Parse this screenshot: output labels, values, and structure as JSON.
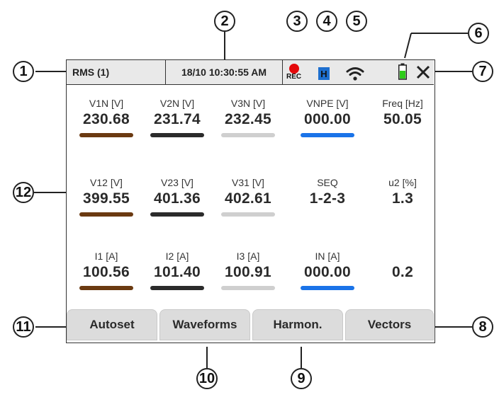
{
  "status": {
    "mode": "RMS (1)",
    "datetime": "18/10 10:30:55 AM",
    "rec_label": "REC",
    "hold_badge": "H",
    "icons": [
      "record-icon",
      "hold-icon",
      "wifi-icon",
      "battery-icon",
      "close-icon"
    ]
  },
  "grid": {
    "rows": [
      [
        {
          "label": "V1N [V]",
          "value": "230.68",
          "bar": "#6b3a11"
        },
        {
          "label": "V2N [V]",
          "value": "231.74",
          "bar": "#2b2b2b"
        },
        {
          "label": "V3N [V]",
          "value": "232.45",
          "bar": "#cfcfcf"
        },
        {
          "label": "VNPE [V]",
          "value": "000.00",
          "bar": "#1a73e8"
        },
        {
          "label": "Freq [Hz]",
          "value": "50.05",
          "bar": ""
        }
      ],
      [
        {
          "label": "V12 [V]",
          "value": "399.55",
          "bar": "#6b3a11"
        },
        {
          "label": "V23 [V]",
          "value": "401.36",
          "bar": "#2b2b2b"
        },
        {
          "label": "V31 [V]",
          "value": "402.61",
          "bar": "#cfcfcf"
        },
        {
          "label": "SEQ",
          "value": "1-2-3",
          "bar": ""
        },
        {
          "label": "u2 [%]",
          "value": "1.3",
          "bar": ""
        }
      ],
      [
        {
          "label": "I1 [A]",
          "value": "100.56",
          "bar": "#6b3a11"
        },
        {
          "label": "I2 [A]",
          "value": "101.40",
          "bar": "#2b2b2b"
        },
        {
          "label": "I3 [A]",
          "value": "100.91",
          "bar": "#cfcfcf"
        },
        {
          "label": "IN [A]",
          "value": "000.00",
          "bar": "#1a73e8"
        },
        {
          "label": "",
          "value": "0.2",
          "bar": ""
        }
      ]
    ]
  },
  "softkeys": [
    "Autoset",
    "Waveforms",
    "Harmon.",
    "Vectors"
  ],
  "callouts": [
    "1",
    "2",
    "3",
    "4",
    "5",
    "6",
    "7",
    "8",
    "9",
    "10",
    "11",
    "12"
  ],
  "colors": {
    "rec": "#e4080a",
    "hold": "#1d6fcf",
    "battery": "#2ecc1a",
    "phase1": "#6b3a11",
    "phase2": "#2b2b2b",
    "phase3": "#cfcfcf",
    "neutral": "#1a73e8"
  }
}
